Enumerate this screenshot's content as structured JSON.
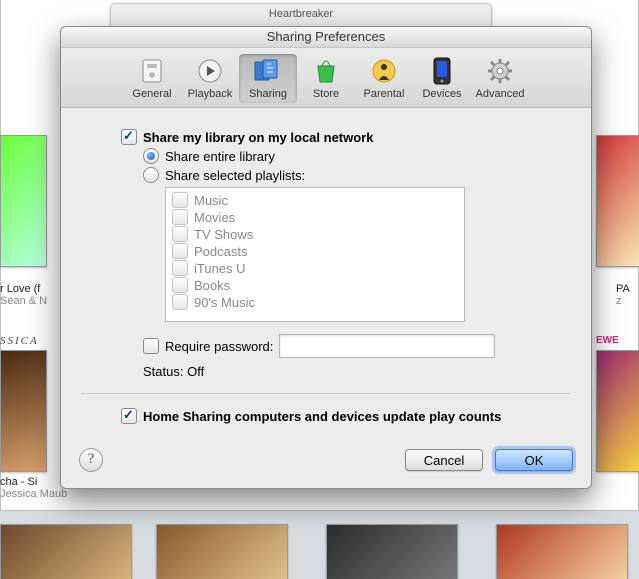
{
  "window": {
    "title": "Sharing Preferences"
  },
  "toolbar": {
    "items": [
      "General",
      "Playback",
      "Sharing",
      "Store",
      "Parental",
      "Devices",
      "Advanced"
    ],
    "selected": "Sharing"
  },
  "options": {
    "share_label": "Share my library on my local network",
    "share_checked": true,
    "radio_entire": "Share entire library",
    "radio_selected": "Share selected playlists:",
    "radio_value": "entire",
    "playlists": [
      "Music",
      "Movies",
      "TV Shows",
      "Podcasts",
      "iTunes U",
      "Books",
      "90's Music"
    ],
    "playlists_checked": [
      false,
      false,
      false,
      false,
      false,
      false,
      false
    ],
    "require_password": "Require password:",
    "require_password_checked": false,
    "password_value": "",
    "status_label": "Status: ",
    "status_value": "Off",
    "home_sharing": "Home Sharing computers and devices update play counts",
    "home_sharing_checked": true
  },
  "buttons": {
    "help": "?",
    "cancel": "Cancel",
    "ok": "OK"
  },
  "background": {
    "tab": "Heartbreaker",
    "items": [
      {
        "title": "r Love (f",
        "sub": "Sean & N"
      },
      {
        "title": "SSICA"
      },
      {
        "title": "cha - Si",
        "sub": "Jessica Maub"
      },
      {
        "title": "PA",
        "sub": "z"
      },
      {
        "title": "EWE"
      }
    ]
  }
}
